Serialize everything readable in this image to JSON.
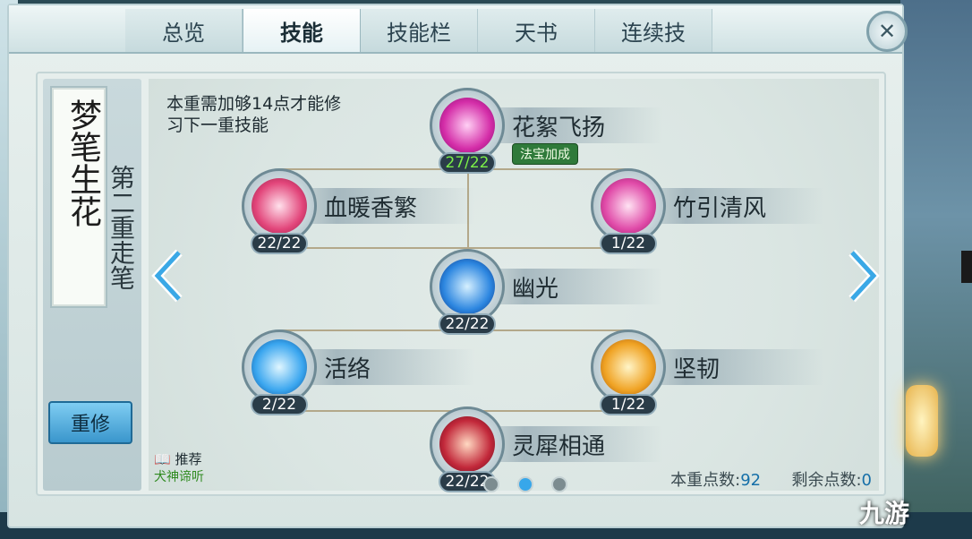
{
  "tabs": [
    {
      "label": "总览",
      "active": false
    },
    {
      "label": "技能",
      "active": true
    },
    {
      "label": "技能栏",
      "active": false
    },
    {
      "label": "天书",
      "active": false
    },
    {
      "label": "连续技",
      "active": false
    }
  ],
  "close_label": "✕",
  "sidebar": {
    "scroll_title": "梦笔生花",
    "layer_name": "第二重走笔",
    "redo_label": "重修"
  },
  "hint": "本重需加够14点才能修习下一重技能",
  "skills": [
    {
      "name": "花絮飞扬",
      "level": "27/22",
      "level_color": "green",
      "badge": "法宝加成",
      "icon": "pink-flower-icon"
    },
    {
      "name": "血暖香繁",
      "level": "22/22",
      "icon": "pink-swirl-icon"
    },
    {
      "name": "竹引清风",
      "level": "1/22",
      "icon": "pink-wind-icon"
    },
    {
      "name": "幽光",
      "level": "22/22",
      "icon": "blue-crystal-icon"
    },
    {
      "name": "活络",
      "level": "2/22",
      "icon": "blue-shield-icon"
    },
    {
      "name": "坚韧",
      "level": "1/22",
      "icon": "gold-shield-icon"
    },
    {
      "name": "灵犀相通",
      "level": "22/22",
      "icon": "red-fox-icon"
    }
  ],
  "recommend": {
    "label": "推荐",
    "sub": "犬神谛听"
  },
  "points": {
    "current_label": "本重点数:",
    "current_value": "92",
    "remaining_label": "剩余点数:",
    "remaining_value": "0"
  },
  "pager": {
    "count": 3,
    "active_index": 1
  },
  "watermark": "九游",
  "colors": {
    "accent": "#37a7ea",
    "level_green": "#7cf048"
  }
}
